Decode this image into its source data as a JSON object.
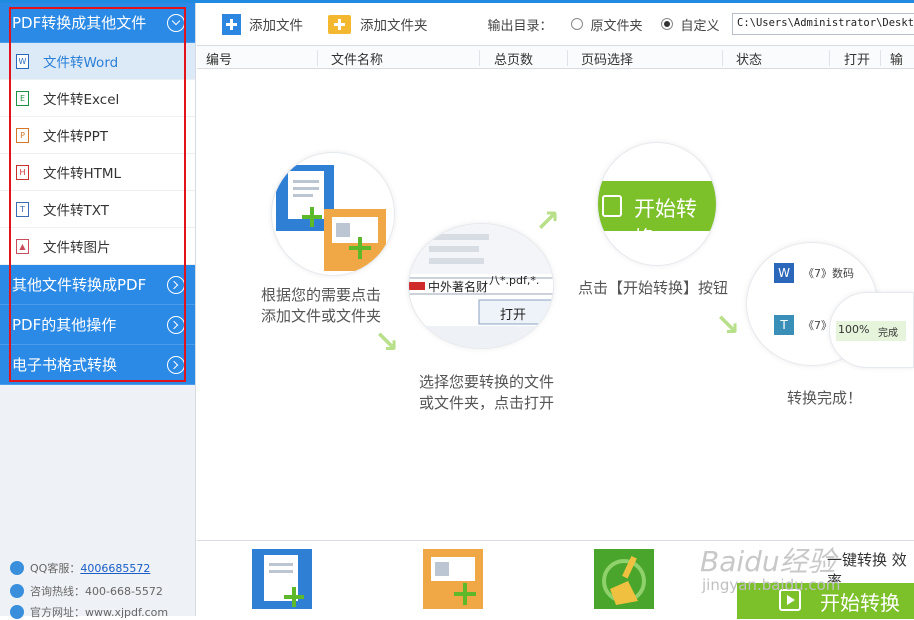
{
  "sidebar": {
    "sections": [
      {
        "label": "PDF转换成其他文件",
        "expanded": true
      },
      {
        "label": "其他文件转换成PDF"
      },
      {
        "label": "PDF的其他操作"
      },
      {
        "label": "电子书格式转换"
      }
    ],
    "items": [
      {
        "label": "文件转Word",
        "icon": "word-file-icon",
        "glyph": "W"
      },
      {
        "label": "文件转Excel",
        "icon": "excel-file-icon",
        "glyph": "E"
      },
      {
        "label": "文件转PPT",
        "icon": "ppt-file-icon",
        "glyph": "P"
      },
      {
        "label": "文件转HTML",
        "icon": "html-file-icon",
        "glyph": "H"
      },
      {
        "label": "文件转TXT",
        "icon": "txt-file-icon",
        "glyph": "T"
      },
      {
        "label": "文件转图片",
        "icon": "image-file-icon",
        "glyph": "▲"
      }
    ],
    "contact": {
      "qq_label": "QQ客服：",
      "qq_value": "4006685572",
      "hotline": "咨询热线：400-668-5572",
      "site": "官方网址：www.xjpdf.com"
    }
  },
  "toolbar": {
    "add_file": "添加文件",
    "add_folder": "添加文件夹",
    "output_label": "输出目录：",
    "radio_original": "原文件夹",
    "radio_custom": "自定义",
    "output_path": "C:\\Users\\Administrator\\Desktop"
  },
  "table": {
    "columns": [
      "编号",
      "文件名称",
      "总页数",
      "页码选择",
      "状态",
      "打开",
      "输出"
    ]
  },
  "guide": {
    "step1": [
      "根据您的需要点击",
      "添加文件或文件夹"
    ],
    "step2": [
      "选择您要转换的文件",
      "或文件夹，点击打开"
    ],
    "step3": "点击【开始转换】按钮",
    "step4": "转换完成！",
    "dialog_filename": "中外著名财",
    "dialog_filter": "八*.pdf,*.",
    "dialog_open": "打开",
    "start_label": "开始转换",
    "done_item1": "《7》数码",
    "done_item2": "《7》",
    "done_percent": "100%",
    "done_status": "完成"
  },
  "bottom": {
    "start_button": "开始转换",
    "side_text": "一键转换 效率"
  },
  "watermark": {
    "logo": "Baidu经验",
    "url": "jingyan.baidu.com"
  },
  "colors": {
    "accent_blue": "#2b8ae6",
    "highlight_red": "#e3131b",
    "green": "#7cc02a"
  }
}
